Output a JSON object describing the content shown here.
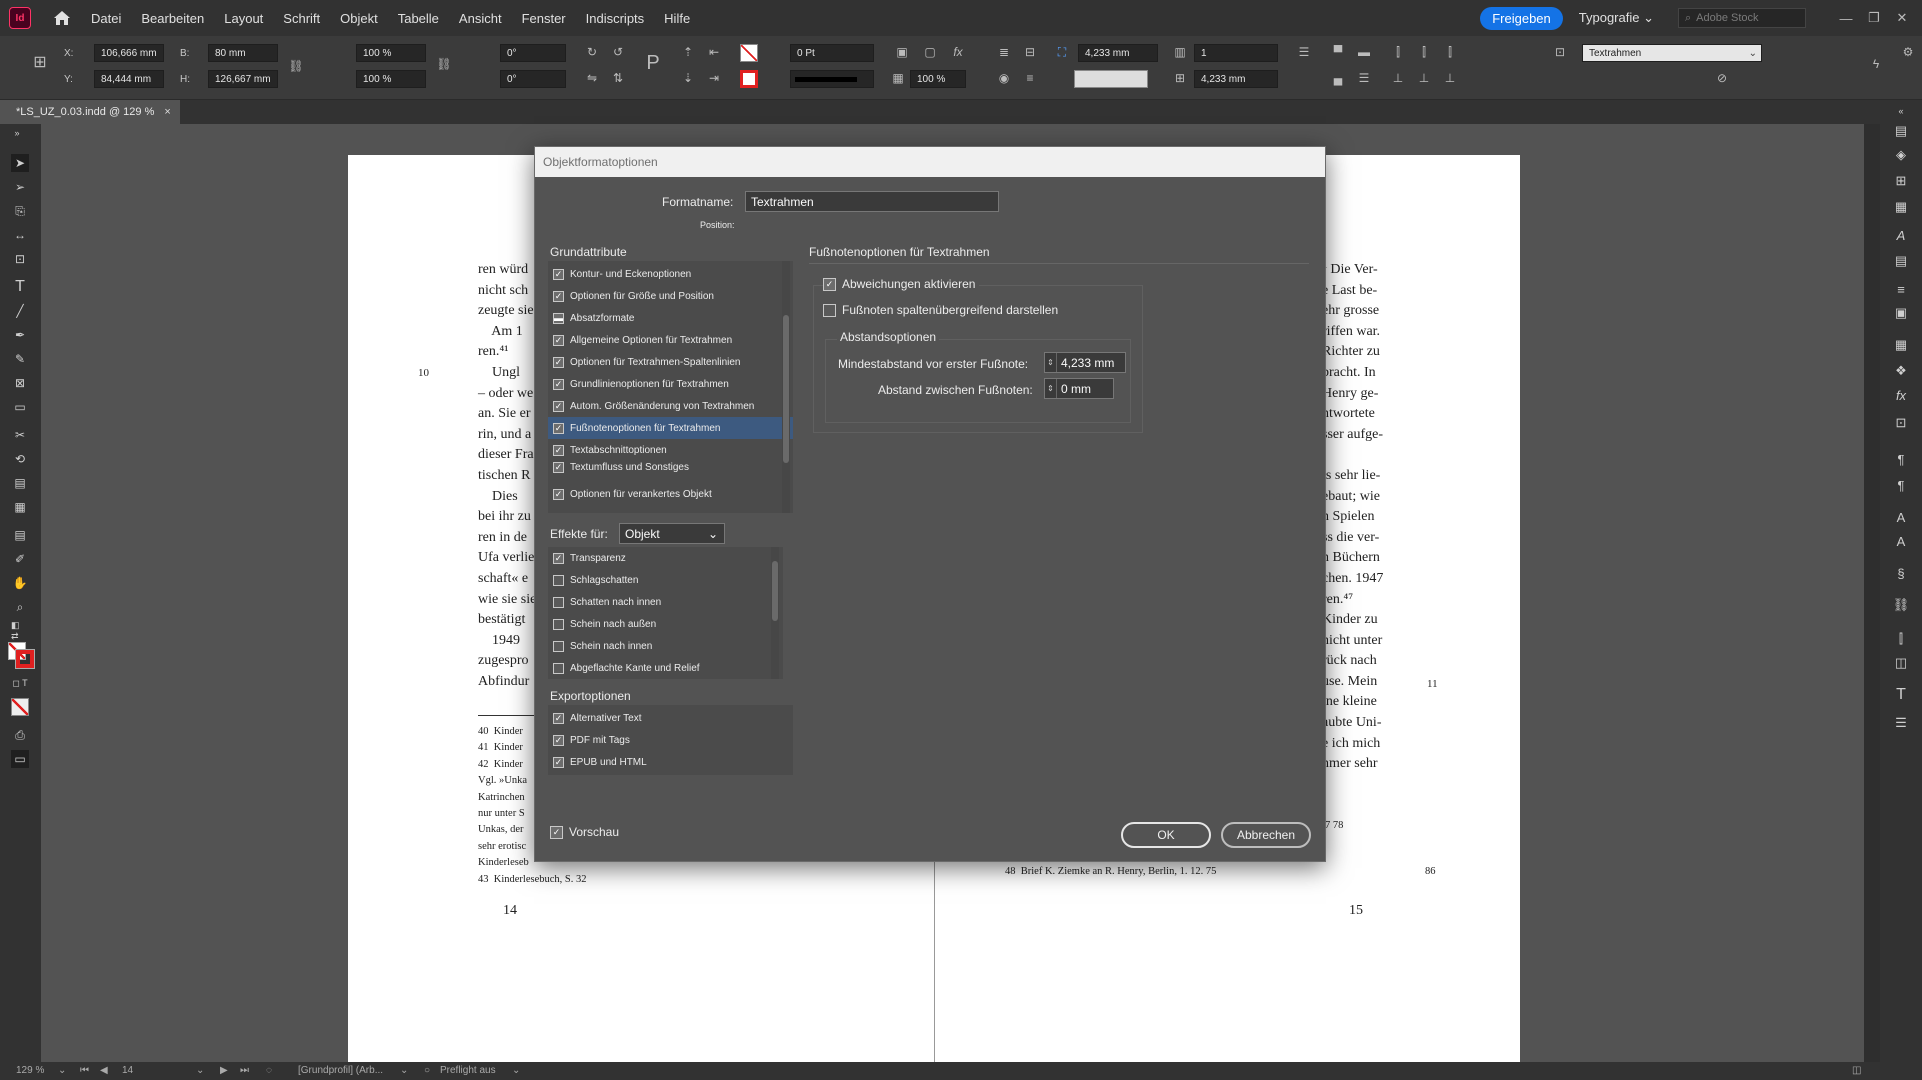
{
  "app": {
    "logo": "Id",
    "home_icon": "home-icon"
  },
  "menu": [
    "Datei",
    "Bearbeiten",
    "Layout",
    "Schrift",
    "Objekt",
    "Tabelle",
    "Ansicht",
    "Fenster",
    "Indiscripts",
    "Hilfe"
  ],
  "header": {
    "share": "Freigeben",
    "workspace": "Typografie",
    "stock_placeholder": "Adobe Stock"
  },
  "control": {
    "x_label": "X:",
    "x": "106,666 mm",
    "y_label": "Y:",
    "y": "84,444 mm",
    "w_label": "B:",
    "w": "80 mm",
    "h_label": "H:",
    "h": "126,667 mm",
    "scale_x": "100 %",
    "scale_y": "100 %",
    "rotate": "0°",
    "shear": "0°",
    "stroke_weight": "0 Pt",
    "opacity": "100 %",
    "footnote_spacing1": "4,233 mm",
    "footnote_spacing2": "4,233 mm",
    "columns": "1",
    "object_style": "Textrahmen"
  },
  "document": {
    "tab": "*LS_UZ_0.03.indd @ 129 %"
  },
  "left_page": {
    "body": "ren würd\nnicht sch\nzeugte sie\n    Am 1\nren.⁴¹\n    Ungl\n– oder we\nan. Sie er\nrin, und a\ndieser Fra\ntischen R\n    Dies\nbei ihr zu\nren in de\nUfa verlie\nschaft« e\nwie sie sie\nbestätigt\n    1949\nzugespro\nAbfindur",
    "line_number": "10",
    "footnotes": "40  Kinder\n41  Kinder\n42  Kinder\nVgl. »Unka\nKatrinchen\nnur unter S\nUnkas, der\nsehr erotisc\nKinderleseb\n43  Kinderlesebuch, S. 32",
    "page_number": "14"
  },
  "right_page": {
    "body": "⁴ Die Ver-\ne Last be-\nehr grosse\nriffen war.\nRichter zu\nbracht. In\nHenry ge-\nntwortete\nsser aufge-\n\nls sehr lie-\nebaut; wie\nn Spielen\nss die ver-\nn Büchern\nchen. 1947\nren.⁴⁷\nKinder zu\nnicht unter\nrück nach\nuse. Mein\nine kleine\naubte Uni-\ne ich mich\nnmer sehr",
    "line_number": "11",
    "fn_fragment": "7 78",
    "fn48": "48  Brief K. Ziemke an R. Henry, Berlin, 1. 12. 75",
    "fn_num": "86",
    "page_number": "15"
  },
  "dialog": {
    "title": "Objektformatoptionen",
    "style_name_label": "Formatname:",
    "style_name": "Textrahmen",
    "position_label": "Position:",
    "basic_header": "Grundattribute",
    "basic_items": [
      {
        "label": "Kontur- und Eckenoptionen",
        "state": "on"
      },
      {
        "label": "Optionen für Größe und Position",
        "state": "on"
      },
      {
        "label": "Absatzformate",
        "state": "mixed"
      },
      {
        "label": "Allgemeine Optionen für Textrahmen",
        "state": "on"
      },
      {
        "label": "Optionen für Textrahmen-Spaltenlinien",
        "state": "on"
      },
      {
        "label": "Grundlinienoptionen für Textrahmen",
        "state": "on"
      },
      {
        "label": "Autom. Größenänderung von Textrahmen",
        "state": "on"
      },
      {
        "label": "Fußnotenoptionen für Textrahmen",
        "state": "on",
        "selected": true
      },
      {
        "label": "Textabschnittoptionen",
        "state": "on"
      },
      {
        "label": "Textumfluss und Sonstiges",
        "state": "on"
      },
      {
        "label": "Optionen für verankertes Objekt",
        "state": "on"
      }
    ],
    "effects_label": "Effekte für:",
    "effects_target": "Objekt",
    "effect_items": [
      {
        "label": "Transparenz",
        "state": "on"
      },
      {
        "label": "Schlagschatten",
        "state": "off"
      },
      {
        "label": "Schatten nach innen",
        "state": "off"
      },
      {
        "label": "Schein nach außen",
        "state": "off"
      },
      {
        "label": "Schein nach innen",
        "state": "off"
      },
      {
        "label": "Abgeflachte Kante und Relief",
        "state": "off"
      }
    ],
    "export_header": "Exportoptionen",
    "export_items": [
      {
        "label": "Alternativer Text",
        "state": "on"
      },
      {
        "label": "PDF mit Tags",
        "state": "on"
      },
      {
        "label": "EPUB und HTML",
        "state": "on"
      }
    ],
    "section_title": "Fußnotenoptionen für Textrahmen",
    "override_label": "Abweichungen aktivieren",
    "span_columns_label": "Fußnoten spaltenübergreifend darstellen",
    "spacing_group": "Abstandsoptionen",
    "min_space_label": "Mindestabstand vor erster Fußnote:",
    "min_space_value": "4,233 mm",
    "between_label": "Abstand zwischen Fußnoten:",
    "between_value": "0 mm",
    "preview_label": "Vorschau",
    "ok": "OK",
    "cancel": "Abbrechen"
  },
  "status": {
    "zoom": "129 %",
    "page": "14",
    "profile": "[Grundprofil] (Arb...",
    "preflight": "Preflight aus"
  }
}
